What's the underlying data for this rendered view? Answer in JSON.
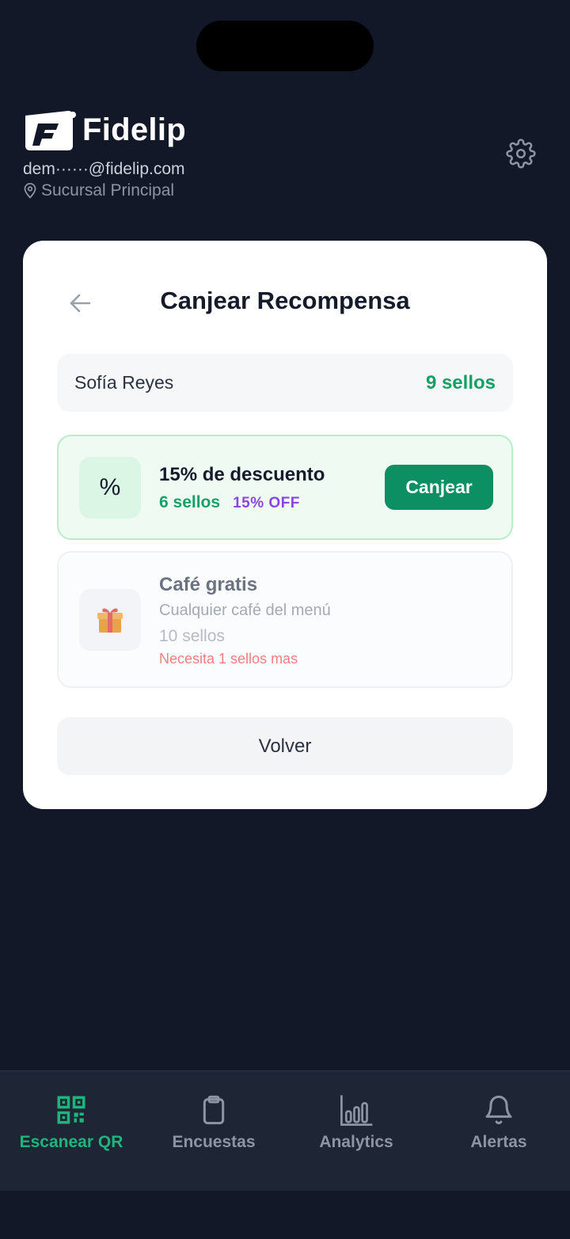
{
  "header": {
    "brand_name": "Fidelip",
    "email": "dem······@fidelip.com",
    "branch": "Sucursal Principal"
  },
  "redeem": {
    "title": "Canjear Recompensa",
    "customer": {
      "name": "Sofía Reyes",
      "stamps": "9 sellos"
    },
    "rewards": [
      {
        "icon": "%",
        "title": "15% de descuento",
        "stamps": "6 sellos",
        "badge": "15% OFF",
        "action_label": "Canjear",
        "available": true
      },
      {
        "icon": "gift-icon",
        "title": "Café gratis",
        "description": "Cualquier café del menú",
        "stamps": "10 sellos",
        "needs": "Necesita 1 sellos mas",
        "available": false
      }
    ],
    "back_label": "Volver"
  },
  "tabbar": {
    "tabs": [
      {
        "label": "Escanear QR",
        "icon": "qr-code-icon",
        "active": true
      },
      {
        "label": "Encuestas",
        "icon": "clipboard-icon",
        "active": false
      },
      {
        "label": "Analytics",
        "icon": "bar-chart-icon",
        "active": false
      },
      {
        "label": "Alertas",
        "icon": "bell-icon",
        "active": false
      }
    ]
  },
  "colors": {
    "background": "#121828",
    "accent_green": "#0b8f63",
    "stamp_green": "#16a067",
    "badge_purple": "#8a45e3",
    "warning_red": "#f07f7f"
  }
}
